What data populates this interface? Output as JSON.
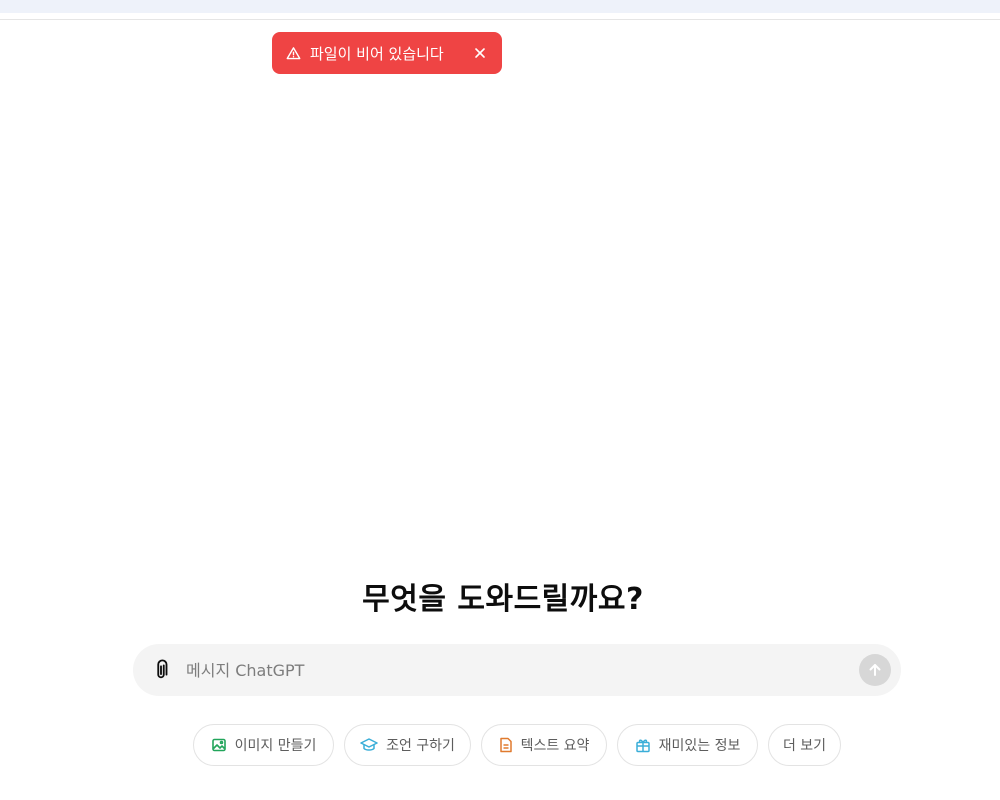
{
  "toast": {
    "message": "파일이 비어 있습니다",
    "icon": "warning-icon",
    "close_icon": "close-icon",
    "color": "#ef4444"
  },
  "main": {
    "headline": "무엇을 도와드릴까요?"
  },
  "composer": {
    "placeholder": "메시지 ChatGPT",
    "value": "",
    "attach_icon": "paperclip-icon",
    "send_icon": "arrow-up-icon"
  },
  "suggestions": [
    {
      "label": "이미지 만들기",
      "icon": "image-icon",
      "color": "#22a55b"
    },
    {
      "label": "조언 구하기",
      "icon": "graduation-cap-icon",
      "color": "#3aaed8"
    },
    {
      "label": "텍스트 요약",
      "icon": "document-icon",
      "color": "#e07a2e"
    },
    {
      "label": "재미있는 정보",
      "icon": "gift-icon",
      "color": "#3aaed8"
    },
    {
      "label": "더 보기",
      "icon": "",
      "color": ""
    }
  ]
}
